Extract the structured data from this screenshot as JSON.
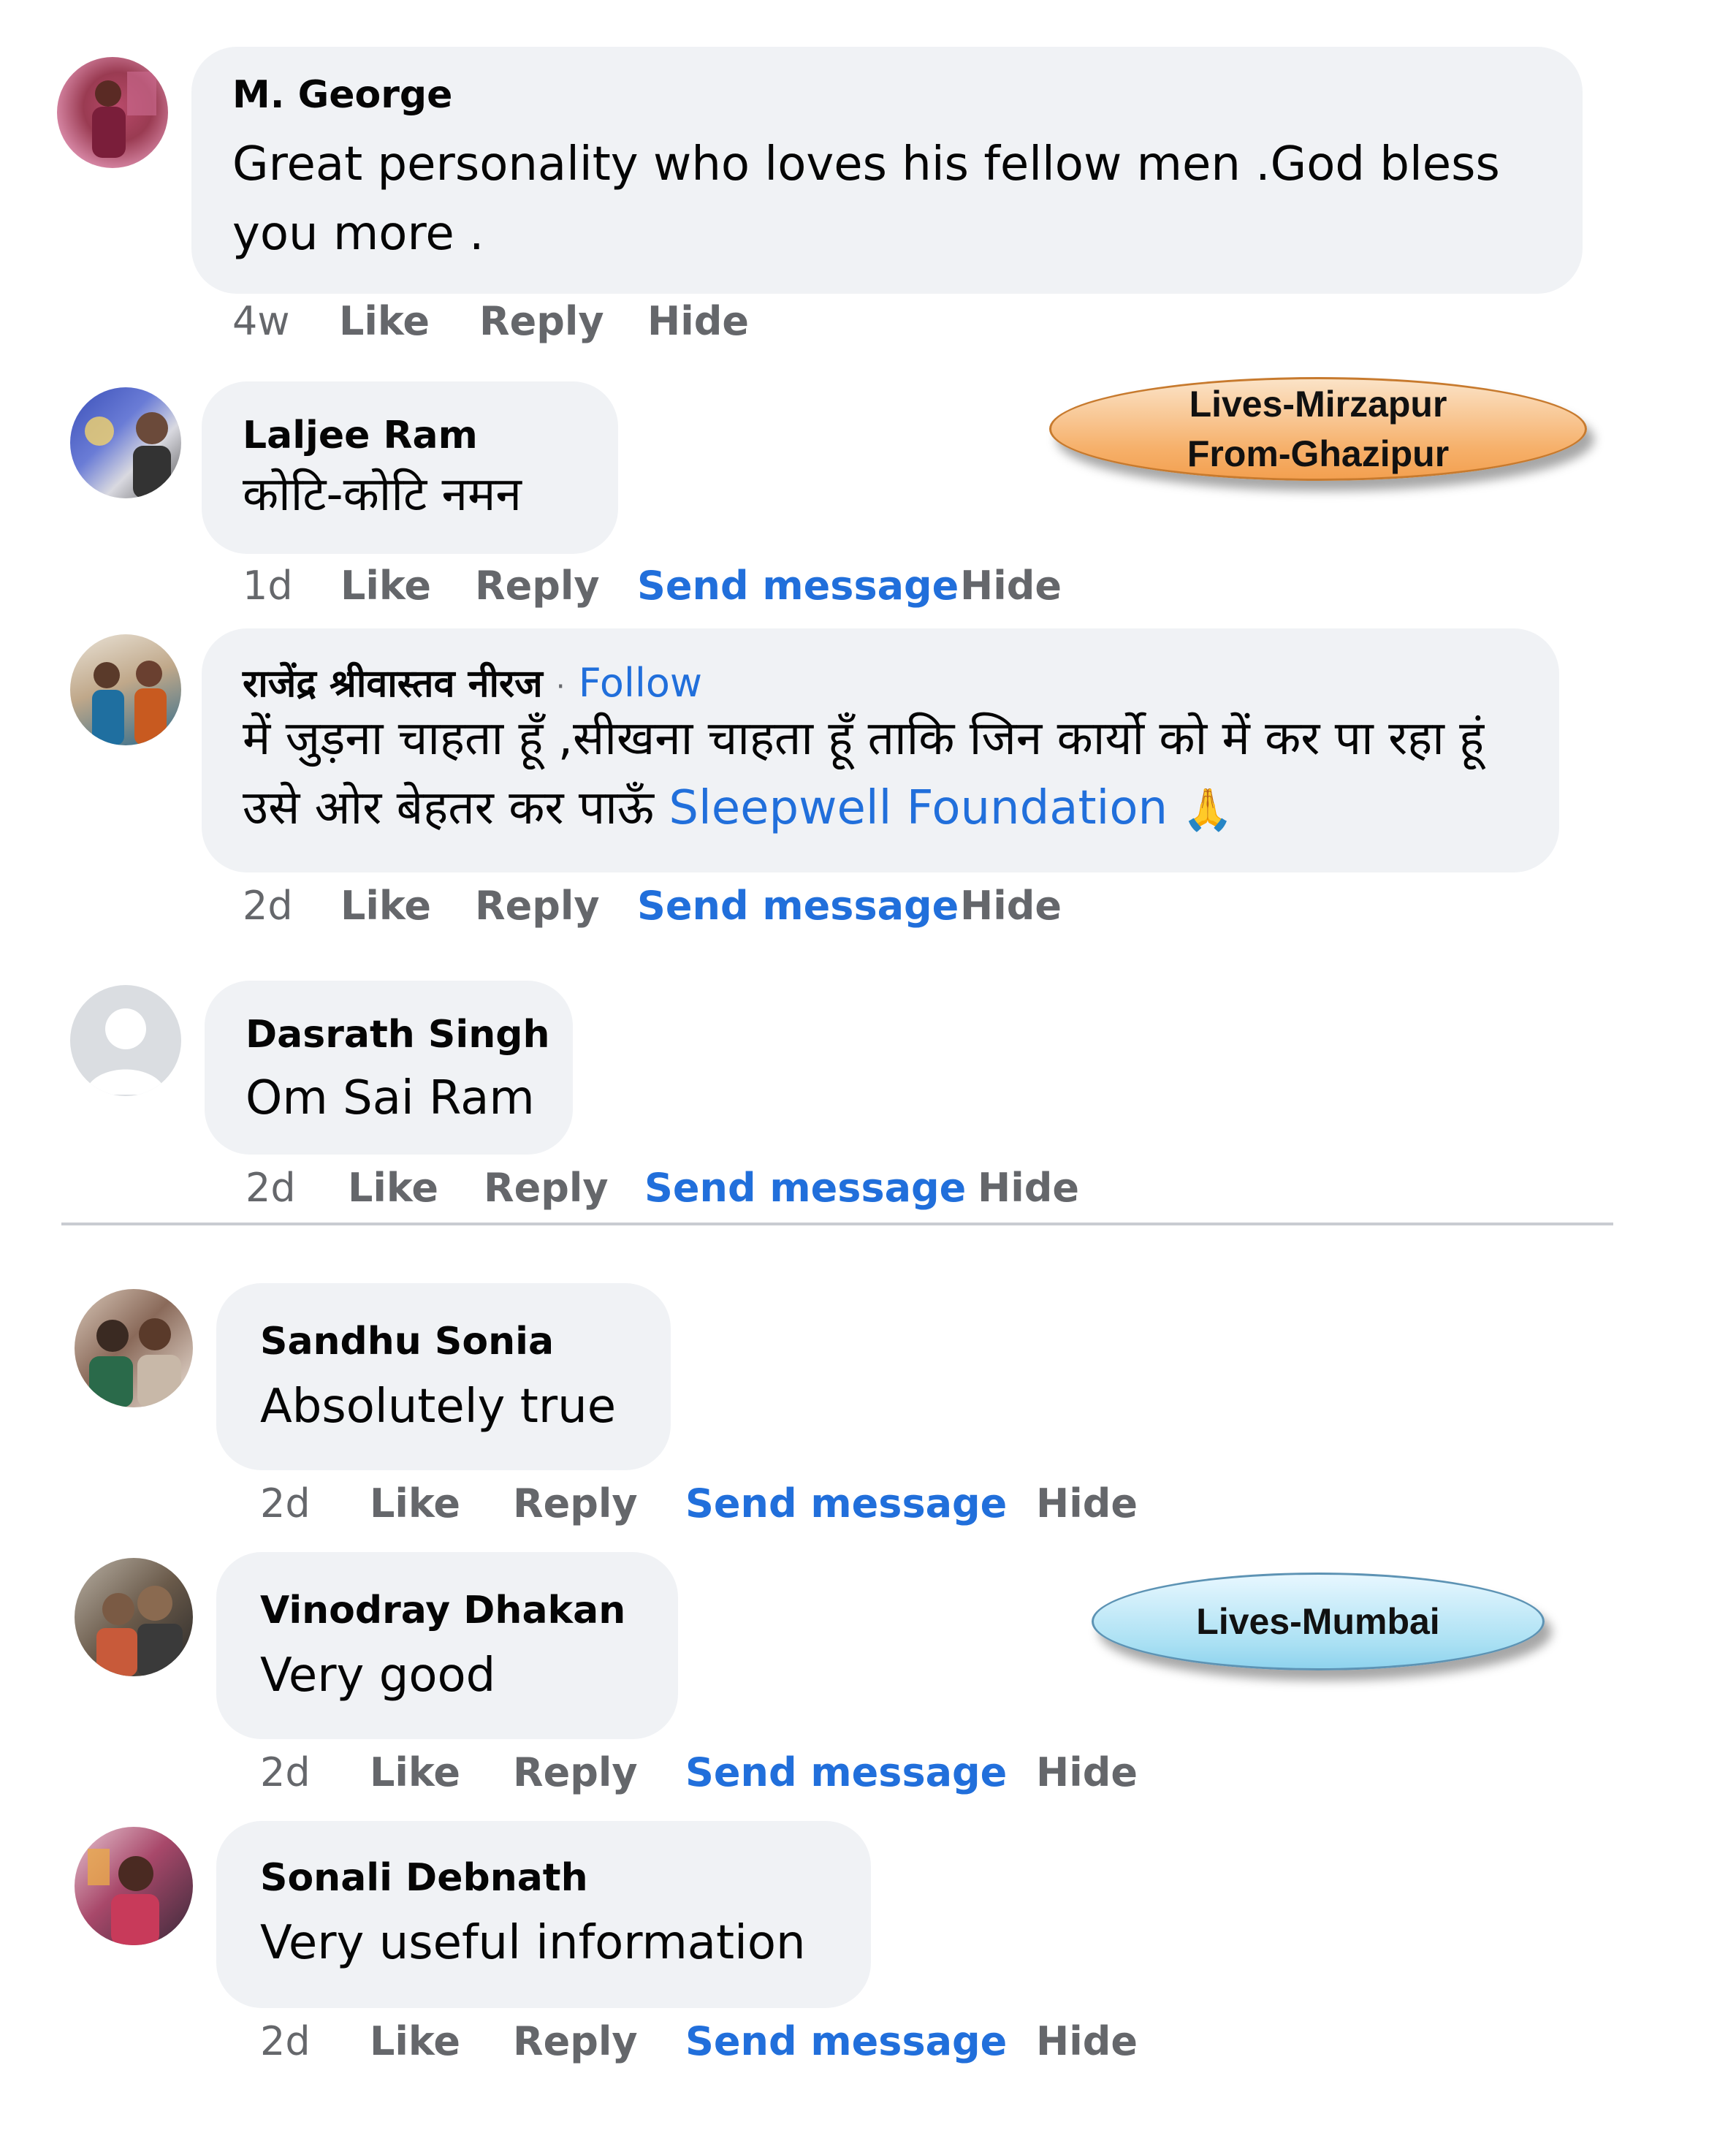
{
  "comments": [
    {
      "author": "M. George",
      "text": "Great personality who loves his fellow men .God bless you more .",
      "time": "4w",
      "like": "Like",
      "reply": "Reply",
      "hide": "Hide"
    },
    {
      "author": "Laljee Ram",
      "text": "कोटि-कोटि नमन",
      "time": "1d",
      "like": "Like",
      "reply": "Reply",
      "send": "Send message",
      "hide": "Hide"
    },
    {
      "author": "राजेंद्र श्रीवास्तव नीरज",
      "dot": "·",
      "follow": "Follow",
      "text": "में जुड़ना चाहता हूँ ,सीखना चाहता हूँ ताकि जिन कार्यो को में कर पा रहा हूं उसे ओर बेहतर कर पाऊँ",
      "tag": "Sleepwell Foundation",
      "emoji": "🙏",
      "time": "2d",
      "like": "Like",
      "reply": "Reply",
      "send": "Send message",
      "hide": "Hide"
    },
    {
      "author": "Dasrath Singh",
      "text": "Om Sai Ram",
      "time": "2d",
      "like": "Like",
      "reply": "Reply",
      "send": "Send message",
      "hide": "Hide"
    },
    {
      "author": "Sandhu Sonia",
      "text": "Absolutely true",
      "time": "2d",
      "like": "Like",
      "reply": "Reply",
      "send": "Send message",
      "hide": "Hide"
    },
    {
      "author": "Vinodray Dhakan",
      "text": "Very good",
      "time": "2d",
      "like": "Like",
      "reply": "Reply",
      "send": "Send message",
      "hide": "Hide"
    },
    {
      "author": "Sonali Debnath",
      "text": "Very useful information",
      "time": "2d",
      "like": "Like",
      "reply": "Reply",
      "send": "Send message",
      "hide": "Hide"
    }
  ],
  "callouts": {
    "mirzapur": {
      "line1": "Lives-Mirzapur",
      "line2": "From-Ghazipur",
      "color": "#f6b06a"
    },
    "mumbai": {
      "line1": "Lives-Mumbai",
      "color": "#a9e0f3"
    }
  },
  "colors": {
    "bubble": "#f0f2f5",
    "link": "#216fdb",
    "meta": "#65676b"
  }
}
